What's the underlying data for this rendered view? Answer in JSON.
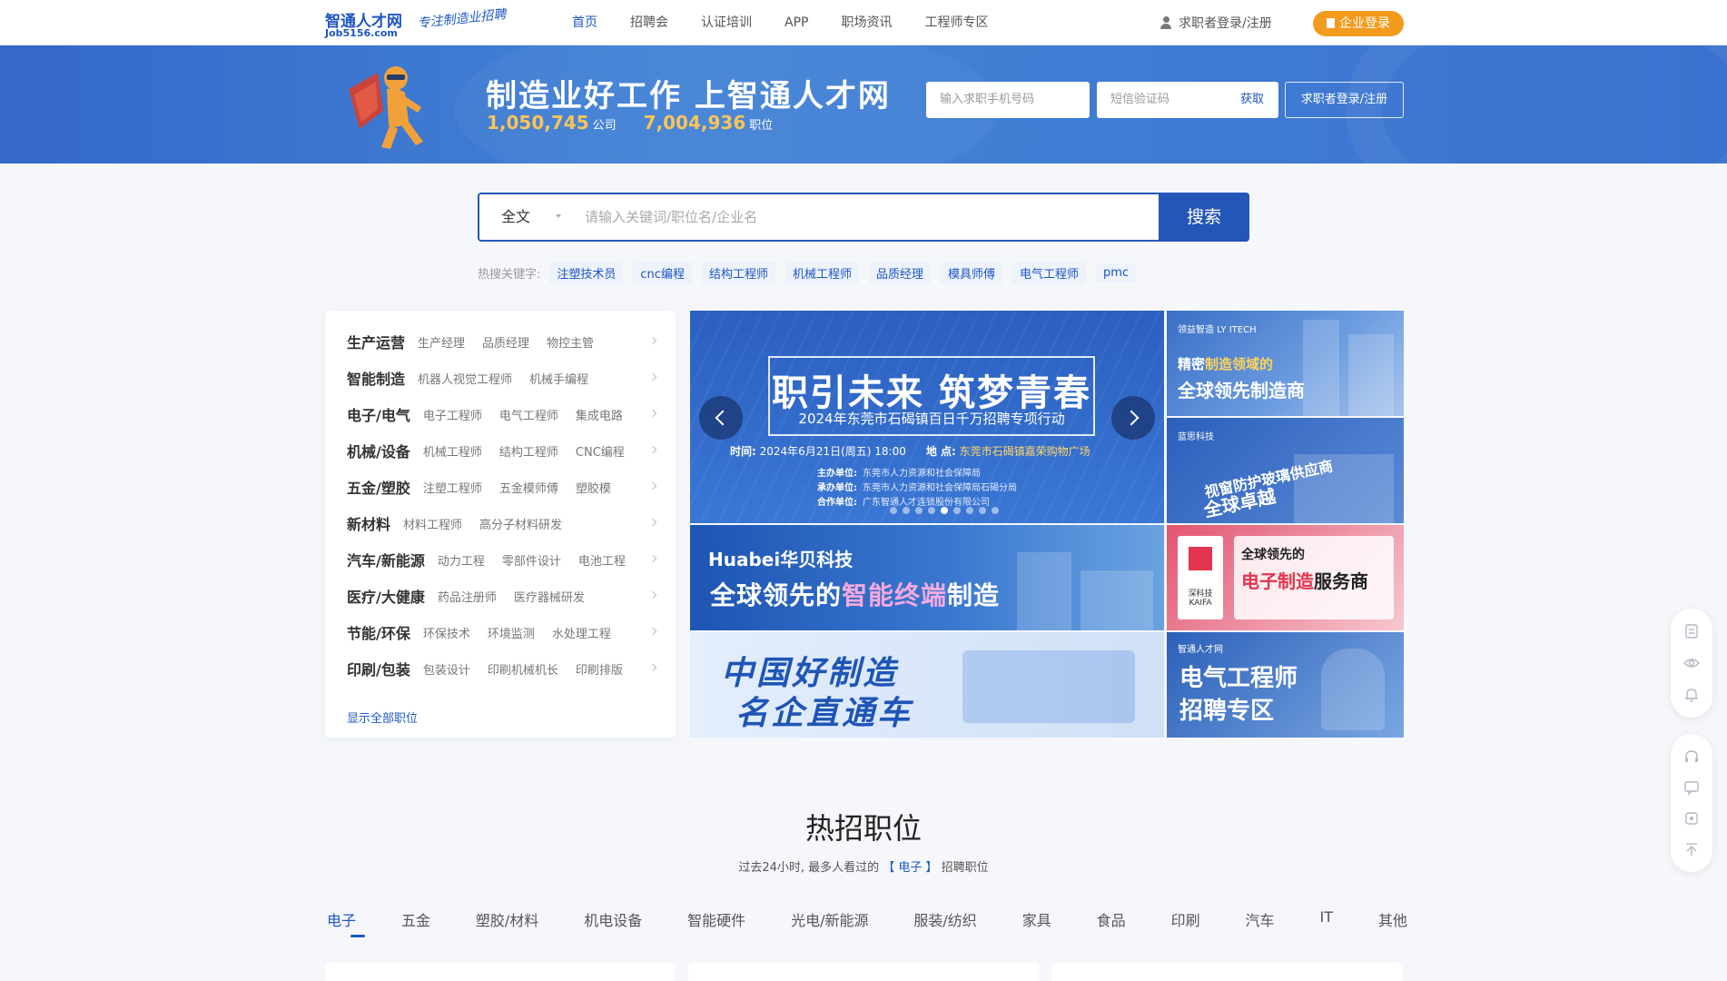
{
  "nav": {
    "logo_cn": "智通人才网",
    "logo_en": "Job5156.com",
    "slogan": "专注制造业招聘",
    "links": [
      "首页",
      "招聘会",
      "认证培训",
      "APP",
      "职场资讯",
      "工程师专区"
    ],
    "active_index": 0,
    "login_label": "求职者登录/注册",
    "enterprise_login_label": "企业登录"
  },
  "banner": {
    "title": "制造业好工作 上智通人才网",
    "company_count": "1,050,745",
    "company_unit": "公司",
    "job_count": "7,004,936",
    "job_unit": "职位",
    "phone_placeholder": "输入求职手机号码",
    "sms_placeholder": "短信验证码",
    "sms_get": "获取",
    "login_button": "求职者登录/注册"
  },
  "search": {
    "type_selected": "全文",
    "placeholder": "请输入关键词/职位名/企业名",
    "button": "搜索",
    "hot_label": "热搜关键字:",
    "hot_items": [
      "注塑技术员",
      "cnc编程",
      "结构工程师",
      "机械工程师",
      "品质经理",
      "模具师傅",
      "电气工程师",
      "pmc"
    ]
  },
  "categories": {
    "rows": [
      {
        "title": "生产运营",
        "subs": [
          "生产经理",
          "品质经理",
          "物控主管"
        ]
      },
      {
        "title": "智能制造",
        "subs": [
          "机器人视觉工程师",
          "机械手编程"
        ]
      },
      {
        "title": "电子/电气",
        "subs": [
          "电子工程师",
          "电气工程师",
          "集成电路"
        ]
      },
      {
        "title": "机械/设备",
        "subs": [
          "机械工程师",
          "结构工程师",
          "CNC编程"
        ]
      },
      {
        "title": "五金/塑胶",
        "subs": [
          "注塑工程师",
          "五金模师傅",
          "塑胶模"
        ]
      },
      {
        "title": "新材料",
        "subs": [
          "材料工程师",
          "高分子材料研发"
        ]
      },
      {
        "title": "汽车/新能源",
        "subs": [
          "动力工程",
          "零部件设计",
          "电池工程"
        ]
      },
      {
        "title": "医疗/大健康",
        "subs": [
          "药品注册师",
          "医疗器械研发"
        ]
      },
      {
        "title": "节能/环保",
        "subs": [
          "环保技术",
          "环境监测",
          "水处理工程"
        ]
      },
      {
        "title": "印刷/包装",
        "subs": [
          "包装设计",
          "印刷机械机长",
          "印刷排版"
        ]
      }
    ],
    "show_all": "显示全部职位"
  },
  "carousel": {
    "title": "职引未来 筑梦青春",
    "subtitle": "2024年东莞市石碣镇百日千万招聘专项行动",
    "time_label": "时间:",
    "time_value": "2024年6月21日(周五) 18:00",
    "place_label": "地 点:",
    "place_value": "东莞市石碣镇嘉荣购物广场",
    "host_label": "主办单位:",
    "host_value": "东莞市人力资源和社会保障局",
    "co_label": "承办单位:",
    "co_value": "东莞市人力资源和社会保障局石碣分局",
    "partner_label": "合作单位:",
    "partner_value": "广东智通人才连锁股份有限公司",
    "dot_count": 9,
    "active_dot": 4
  },
  "ads": {
    "huabei_logo": "Huabei华贝科技",
    "huabei_text_1": "全球领先的",
    "huabei_text_2": "智能终端",
    "huabei_text_3": "制造",
    "cn_line1": "中国好制造",
    "cn_line2": "名企直通车",
    "ly_small": "领益智造 LY ITECH",
    "ly_line1_a": "精密",
    "ly_line1_b": "制造领域的",
    "ly_line2": "全球领先制造商",
    "lens_small": "蓝思科技",
    "lens_line1": "视窗防护玻璃供应商",
    "lens_line2": "全球卓越",
    "kaifa_name": "深科技 KAIFA",
    "kaifa_line1": "全球领先的",
    "kaifa_line2_a": "电子制造",
    "kaifa_line2_b": "服务商",
    "elec_small": "智通人才网",
    "elec_line1": "电气工程师",
    "elec_line2": "招聘专区"
  },
  "hot": {
    "title": "热招职位",
    "desc_prefix": "过去24小时, 最多人看过的",
    "desc_keyword": "【 电子 】",
    "desc_suffix": "招聘职位",
    "tabs": [
      "电子",
      "五金",
      "塑胶/材料",
      "机电设备",
      "智能硬件",
      "光电/新能源",
      "服装/纺织",
      "家具",
      "食品",
      "印刷",
      "汽车",
      "IT",
      "其他"
    ],
    "active_tab": 0
  },
  "colors": {
    "brand_blue": "#1d56c5",
    "accent_orange": "#f29b1d",
    "banner_blue": "#3b72cf"
  }
}
